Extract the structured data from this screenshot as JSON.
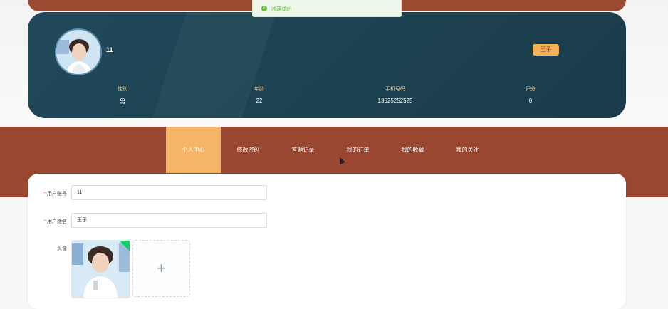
{
  "toast": {
    "message": "收藏成功"
  },
  "profile": {
    "username": "11",
    "role": "王子",
    "stats": [
      {
        "label": "性别",
        "value": "男"
      },
      {
        "label": "年龄",
        "value": "22"
      },
      {
        "label": "手机号码",
        "value": "13525252525"
      },
      {
        "label": "积分",
        "value": "0"
      }
    ]
  },
  "nav": {
    "items": [
      {
        "label": "个人中心",
        "active": true
      },
      {
        "label": "修改密码"
      },
      {
        "label": "答题记录"
      },
      {
        "label": "我的订单"
      },
      {
        "label": "我的收藏"
      },
      {
        "label": "我的关注"
      }
    ]
  },
  "form": {
    "account": {
      "label": "用户账号",
      "value": "11"
    },
    "name": {
      "label": "用户姓名",
      "value": "王子"
    },
    "avatar": {
      "label": "头像",
      "add_icon": "+"
    }
  },
  "colors": {
    "brand": "#9a4731",
    "card": "#1d4352",
    "accent": "#f6b466",
    "success": "#67c23a"
  }
}
